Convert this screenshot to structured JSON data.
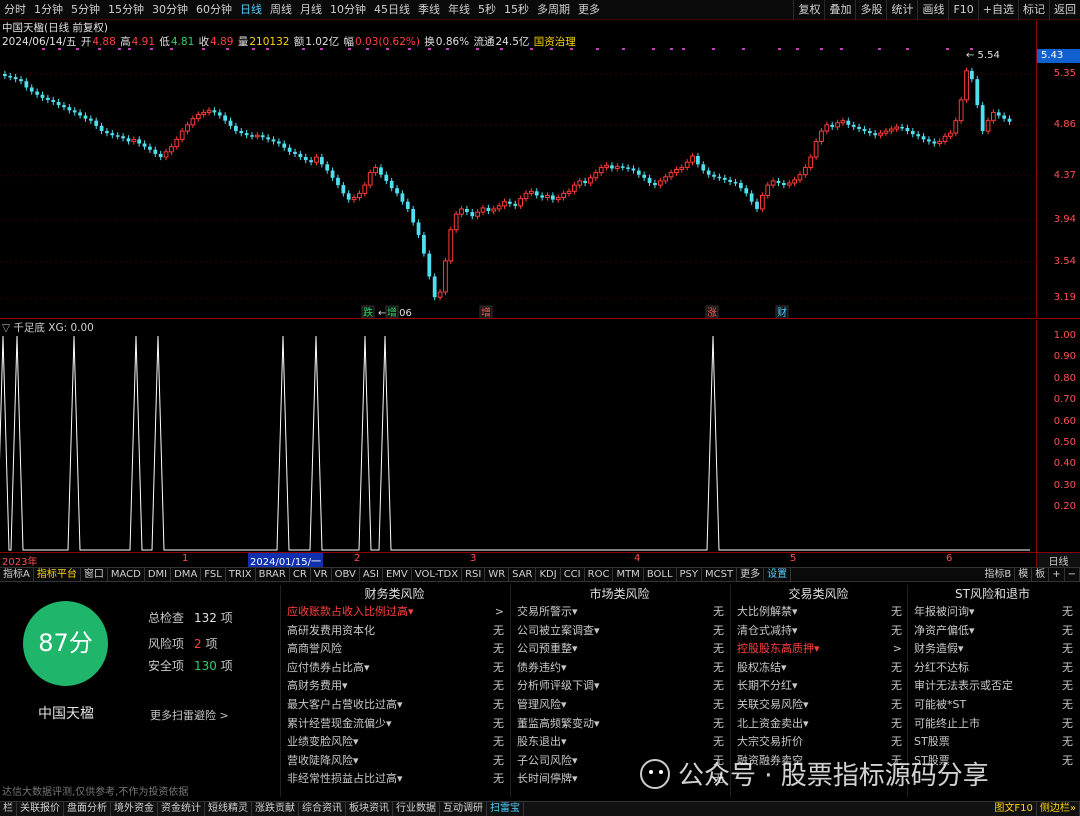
{
  "toolbar": {
    "periods": [
      "分时",
      "1分钟",
      "5分钟",
      "15分钟",
      "30分钟",
      "60分钟",
      "日线",
      "周线",
      "月线",
      "10分钟",
      "45日线",
      "季线",
      "年线",
      "5秒",
      "15秒",
      "多周期",
      "更多"
    ],
    "active_period": "日线",
    "right_buttons": [
      "复权",
      "叠加",
      "多股",
      "统计",
      "画线",
      "F10",
      "+自选",
      "标记",
      "返回"
    ]
  },
  "info": {
    "line1": "中国天楹(日线 前复权)",
    "date": "2024/06/14/五",
    "open_label": "开",
    "open": "4.88",
    "high_label": "高",
    "high": "4.91",
    "low_label": "低",
    "low": "4.81",
    "close_label": "收",
    "close": "4.89",
    "vol_label": "量",
    "vol": "210132",
    "amount_label": "额",
    "amount": "1.02亿",
    "change_label": "幅",
    "change": "0.03(0.62%)",
    "turnover_label": "换",
    "turnover": "0.86%",
    "float_label": "流通",
    "float": "24.5亿",
    "tag": "国资治理"
  },
  "price_axis": {
    "ticks": [
      "5.35",
      "4.86",
      "4.37",
      "3.94",
      "3.54",
      "3.19"
    ],
    "current": "5.43"
  },
  "annotations": {
    "high_mark": "5.54",
    "low_mark": "3.06",
    "markers": [
      {
        "text": "跌",
        "color": "#2fd06a"
      },
      {
        "text": "增",
        "color": "#2fd06a"
      },
      {
        "text": "增",
        "color": "#ff6060"
      },
      {
        "text": "涨",
        "color": "#ff6060"
      },
      {
        "text": "财",
        "color": "#4fd0ff"
      }
    ]
  },
  "indicator": {
    "title": "千足底 XG: 0.00",
    "ticks": [
      "1.00",
      "0.90",
      "0.80",
      "0.70",
      "0.60",
      "0.50",
      "0.40",
      "0.30",
      "0.20"
    ],
    "spikes": [
      3,
      17,
      74,
      136,
      158,
      283,
      316,
      365,
      385,
      713
    ]
  },
  "date_bar": {
    "labels": [
      {
        "text": "2023年",
        "x": 2
      },
      {
        "text": "1",
        "x": 182
      },
      {
        "text": "2",
        "x": 354
      },
      {
        "text": "3",
        "x": 470
      },
      {
        "text": "4",
        "x": 634
      },
      {
        "text": "5",
        "x": 790
      },
      {
        "text": "6",
        "x": 946
      }
    ],
    "selected": "2024/01/15/一",
    "right": "日线"
  },
  "tabs": {
    "items": [
      "指标A",
      "指标平台",
      "窗口",
      "MACD",
      "DMI",
      "DMA",
      "FSL",
      "TRIX",
      "BRAR",
      "CR",
      "VR",
      "OBV",
      "ASI",
      "EMV",
      "VOL-TDX",
      "RSI",
      "WR",
      "SAR",
      "KDJ",
      "CCI",
      "ROC",
      "MTM",
      "BOLL",
      "PSY",
      "MCST",
      "更多",
      "设置"
    ],
    "active": "指标平台",
    "blue": "设置",
    "right_items": [
      "指标B",
      "模",
      "板",
      "+",
      "−"
    ]
  },
  "panel": {
    "score": "87分",
    "company": "中国天楹",
    "total_label": "总检查",
    "total": "132",
    "total_unit": "项",
    "risk_label": "风险项",
    "risk": "2",
    "risk_unit": "项",
    "safe_label": "安全项",
    "safe": "130",
    "safe_unit": "项",
    "more": "更多扫雷避险 >",
    "disclaimer": "达信大数据评测,仅供参考,不作为投资依据"
  },
  "risk_columns": [
    {
      "title": "财务类风险",
      "rows": [
        {
          "label": "应收账款占收入比例过高▾",
          "result": ">",
          "hi": true
        },
        {
          "label": "高研发费用资本化",
          "result": "无"
        },
        {
          "label": "高商誉风险",
          "result": "无"
        },
        {
          "label": "应付债券占比高▾",
          "result": "无"
        },
        {
          "label": "高财务费用▾",
          "result": "无"
        },
        {
          "label": "最大客户占营收比过高▾",
          "result": "无"
        },
        {
          "label": "累计经营现金流偏少▾",
          "result": "无"
        },
        {
          "label": "业绩变脸风险▾",
          "result": "无"
        },
        {
          "label": "营收陡降风险▾",
          "result": "无"
        },
        {
          "label": "非经常性损益占比过高▾",
          "result": "无"
        }
      ]
    },
    {
      "title": "市场类风险",
      "rows": [
        {
          "label": "交易所警示▾",
          "result": "无"
        },
        {
          "label": "公司被立案调查▾",
          "result": "无"
        },
        {
          "label": "公司预重整▾",
          "result": "无"
        },
        {
          "label": "债券违约▾",
          "result": "无"
        },
        {
          "label": "分析师评级下调▾",
          "result": "无"
        },
        {
          "label": "管理风险▾",
          "result": "无"
        },
        {
          "label": "董监高频繁变动▾",
          "result": "无"
        },
        {
          "label": "股东退出▾",
          "result": "无"
        },
        {
          "label": "子公司风险▾",
          "result": "无"
        },
        {
          "label": "长时间停牌▾",
          "result": "无"
        }
      ]
    },
    {
      "title": "交易类风险",
      "rows": [
        {
          "label": "大比例解禁▾",
          "result": "无"
        },
        {
          "label": "清仓式减持▾",
          "result": "无"
        },
        {
          "label": "控股股东高质押▾",
          "result": ">",
          "hi": true
        },
        {
          "label": "股权冻结▾",
          "result": "无"
        },
        {
          "label": "长期不分红▾",
          "result": "无"
        },
        {
          "label": "关联交易风险▾",
          "result": "无"
        },
        {
          "label": "北上资金卖出▾",
          "result": "无"
        },
        {
          "label": "大宗交易折价",
          "result": "无"
        },
        {
          "label": "融资融券卖空",
          "result": "无"
        },
        {
          "label": "",
          "result": ""
        }
      ]
    },
    {
      "title": "ST风险和退市",
      "rows": [
        {
          "label": "年报被问询▾",
          "result": "无"
        },
        {
          "label": "净资产偏低▾",
          "result": "无"
        },
        {
          "label": "财务造假▾",
          "result": "无"
        },
        {
          "label": "分红不达标",
          "result": "无"
        },
        {
          "label": "审计无法表示或否定",
          "result": "无"
        },
        {
          "label": "可能被*ST",
          "result": "无"
        },
        {
          "label": "可能终止上市",
          "result": "无"
        },
        {
          "label": "ST股票",
          "result": "无"
        },
        {
          "label": "ST股票",
          "result": "无"
        },
        {
          "label": "",
          "result": ""
        }
      ]
    }
  ],
  "watermark": "公众号 · 股票指标源码分享",
  "bottombar": {
    "items": [
      "栏",
      "关联报价",
      "盘面分析",
      "境外资金",
      "资金统计",
      "短线精灵",
      "涨跌贡献",
      "综合资讯",
      "板块资讯",
      "行业数据",
      "互动调研",
      "扫雷宝"
    ],
    "active": "扫雷宝",
    "right": [
      "图文F10",
      "侧边栏»"
    ]
  },
  "colors": {
    "up": "#ff3a3a",
    "down": "#4fe0f0",
    "score_bg": "#1fb56b",
    "frame": "#8b0000"
  },
  "chart_data": {
    "type": "candlestick",
    "note_range": "2023 to 2024/06/14, daily, forward-adjusted",
    "ylim": [
      3.0,
      5.6
    ],
    "closes": [
      5.33,
      5.32,
      5.3,
      5.28,
      5.22,
      5.18,
      5.15,
      5.12,
      5.1,
      5.08,
      5.05,
      5.03,
      5.0,
      4.98,
      4.95,
      4.92,
      4.9,
      4.85,
      4.8,
      4.78,
      4.76,
      4.75,
      4.73,
      4.7,
      4.72,
      4.68,
      4.65,
      4.62,
      4.58,
      4.55,
      4.6,
      4.65,
      4.72,
      4.8,
      4.86,
      4.92,
      4.96,
      4.98,
      5.0,
      4.98,
      4.95,
      4.9,
      4.85,
      4.8,
      4.78,
      4.76,
      4.75,
      4.76,
      4.74,
      4.72,
      4.7,
      4.68,
      4.64,
      4.6,
      4.58,
      4.55,
      4.52,
      4.5,
      4.55,
      4.48,
      4.42,
      4.35,
      4.28,
      4.2,
      4.14,
      4.16,
      4.2,
      4.28,
      4.4,
      4.45,
      4.38,
      4.32,
      4.25,
      4.2,
      4.12,
      4.05,
      3.92,
      3.8,
      3.62,
      3.4,
      3.2,
      3.25,
      3.55,
      3.85,
      4.0,
      4.05,
      4.02,
      3.98,
      4.02,
      4.06,
      4.03,
      4.05,
      4.08,
      4.12,
      4.1,
      4.08,
      4.15,
      4.2,
      4.22,
      4.18,
      4.16,
      4.18,
      4.14,
      4.16,
      4.2,
      4.22,
      4.28,
      4.32,
      4.3,
      4.35,
      4.4,
      4.45,
      4.47,
      4.44,
      4.46,
      4.45,
      4.44,
      4.42,
      4.38,
      4.35,
      4.3,
      4.28,
      4.32,
      4.36,
      4.4,
      4.43,
      4.45,
      4.5,
      4.56,
      4.48,
      4.42,
      4.38,
      4.36,
      4.35,
      4.33,
      4.31,
      4.3,
      4.25,
      4.2,
      4.12,
      4.05,
      4.18,
      4.28,
      4.32,
      4.3,
      4.28,
      4.3,
      4.33,
      4.38,
      4.45,
      4.55,
      4.7,
      4.8,
      4.86,
      4.84,
      4.88,
      4.9,
      4.86,
      4.84,
      4.82,
      4.8,
      4.78,
      4.76,
      4.78,
      4.8,
      4.82,
      4.84,
      4.83,
      4.8,
      4.77,
      4.75,
      4.72,
      4.7,
      4.68,
      4.7,
      4.75,
      4.78,
      4.9,
      5.1,
      5.38,
      5.3,
      5.05,
      4.8,
      4.9,
      4.98,
      4.95,
      4.92,
      4.89
    ]
  }
}
